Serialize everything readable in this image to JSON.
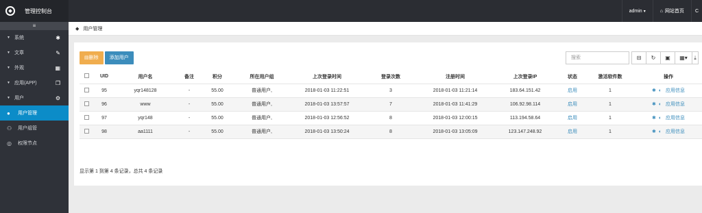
{
  "brand": {
    "title": "管理控制台"
  },
  "topbar": {
    "user": "admin",
    "home_link": "网站首页",
    "exit_partial": "C"
  },
  "sidebar": {
    "toggle": "≡",
    "items": [
      {
        "label": "系统",
        "icon": "gear-icon"
      },
      {
        "label": "文章",
        "icon": "edit-icon"
      },
      {
        "label": "外观",
        "icon": "grid-icon"
      },
      {
        "label": "应用(APP)",
        "icon": "copy-icon"
      },
      {
        "label": "用户",
        "icon": "gears-icon"
      },
      {
        "label": "用户管理",
        "icon": "user-icon",
        "active": true
      },
      {
        "label": "用户组管",
        "icon": "group-icon"
      },
      {
        "label": "权限节点",
        "icon": "circle-icon"
      }
    ]
  },
  "breadcrumb": {
    "label": "用户管理"
  },
  "toolbar": {
    "delete_label": "删除",
    "add_label": "添加用户",
    "search_placeholder": "搜索"
  },
  "table": {
    "headers": [
      "UID",
      "用户名",
      "备注",
      "积分",
      "所在用户组",
      "上次登录时间",
      "登录次数",
      "注册时间",
      "上次登录IP",
      "状态",
      "激活软件数",
      "操作"
    ],
    "rows": [
      {
        "uid": "95",
        "username": "yqr148128",
        "note": "-",
        "points": "55.00",
        "group": "普通用户,",
        "last_login": "2018-01-03 11:22:51",
        "login_count": "3",
        "register_time": "2018-01-03 11:21:14",
        "last_ip": "183.64.151.42",
        "status": "启用",
        "activated": "1",
        "op_label": "应用信息"
      },
      {
        "uid": "96",
        "username": "www",
        "note": "-",
        "points": "55.00",
        "group": "普通用户,",
        "last_login": "2018-01-03 13:57:57",
        "login_count": "7",
        "register_time": "2018-01-03 11:41:29",
        "last_ip": "106.92.98.114",
        "status": "启用",
        "activated": "1",
        "op_label": "应用信息"
      },
      {
        "uid": "97",
        "username": "yqr148",
        "note": "-",
        "points": "55.00",
        "group": "普通用户,",
        "last_login": "2018-01-03 12:56:52",
        "login_count": "8",
        "register_time": "2018-01-03 12:00:15",
        "last_ip": "113.194.58.64",
        "status": "启用",
        "activated": "1",
        "op_label": "应用信息"
      },
      {
        "uid": "98",
        "username": "aa1111",
        "note": "-",
        "points": "55.00",
        "group": "普通用户,",
        "last_login": "2018-01-03 13:50:24",
        "login_count": "8",
        "register_time": "2018-01-03 13:05:09",
        "last_ip": "123.147.248.92",
        "status": "启用",
        "activated": "1",
        "op_label": "应用信息"
      }
    ]
  },
  "pager": {
    "info": "显示第 1 到第 4 条记录，总共 4 条记录"
  }
}
